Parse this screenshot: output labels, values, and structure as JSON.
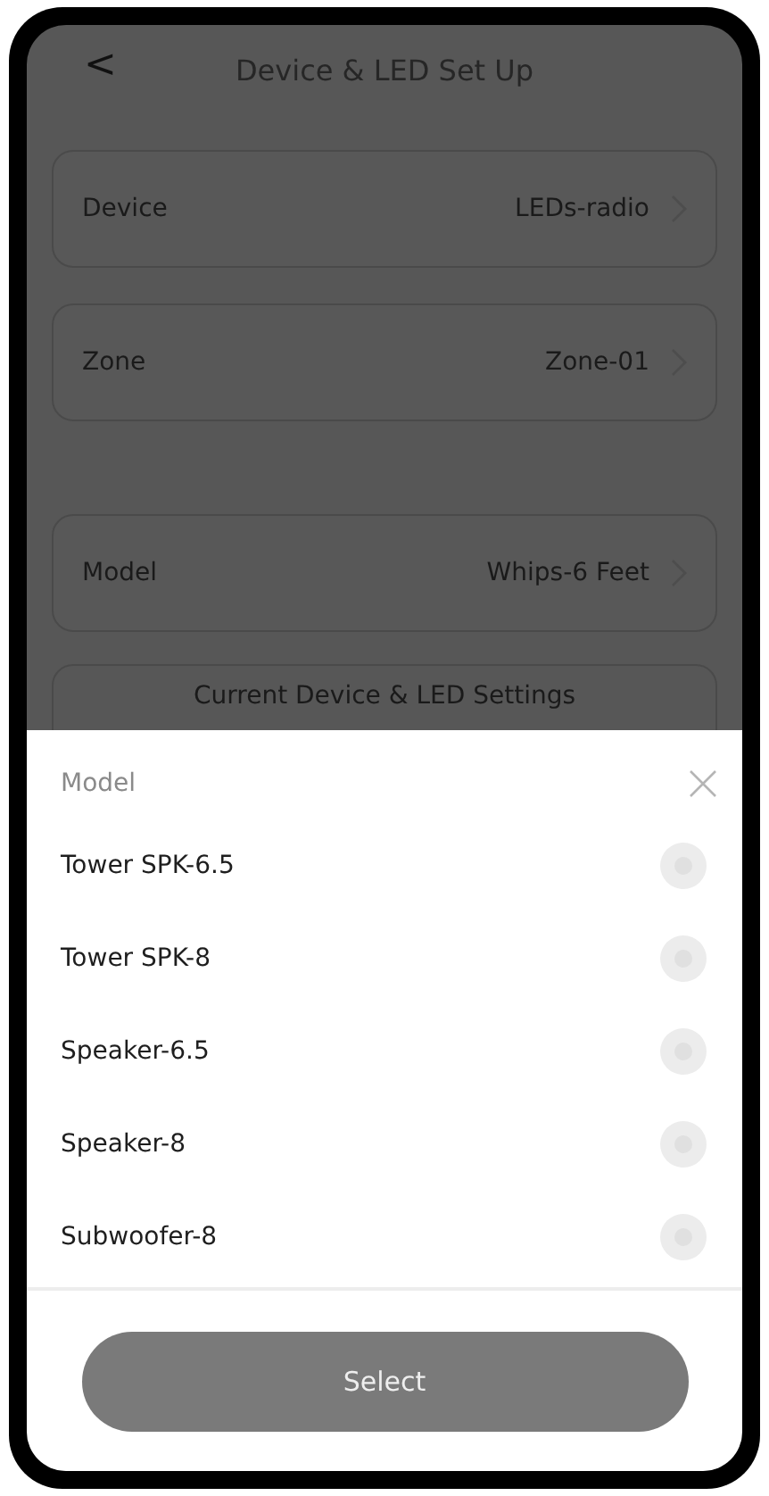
{
  "header": {
    "back": "<",
    "title": "Device & LED Set Up"
  },
  "setting_groups": [
    [
      {
        "label": "Device",
        "value": "LEDs-radio"
      },
      {
        "label": "Zone",
        "value": "Zone-01"
      }
    ],
    [
      {
        "label": "Model",
        "value": "Whips-6 Feet"
      }
    ]
  ],
  "current_settings": {
    "label": "Current Device & LED Settings"
  },
  "sheet": {
    "title": "Model",
    "options": [
      {
        "label": "Tower SPK-6.5",
        "selected": false
      },
      {
        "label": "Tower SPK-8",
        "selected": false
      },
      {
        "label": "Speaker-6.5",
        "selected": false
      },
      {
        "label": "Speaker-8",
        "selected": false
      },
      {
        "label": "Subwoofer-8",
        "selected": false
      }
    ],
    "button": "Select"
  }
}
